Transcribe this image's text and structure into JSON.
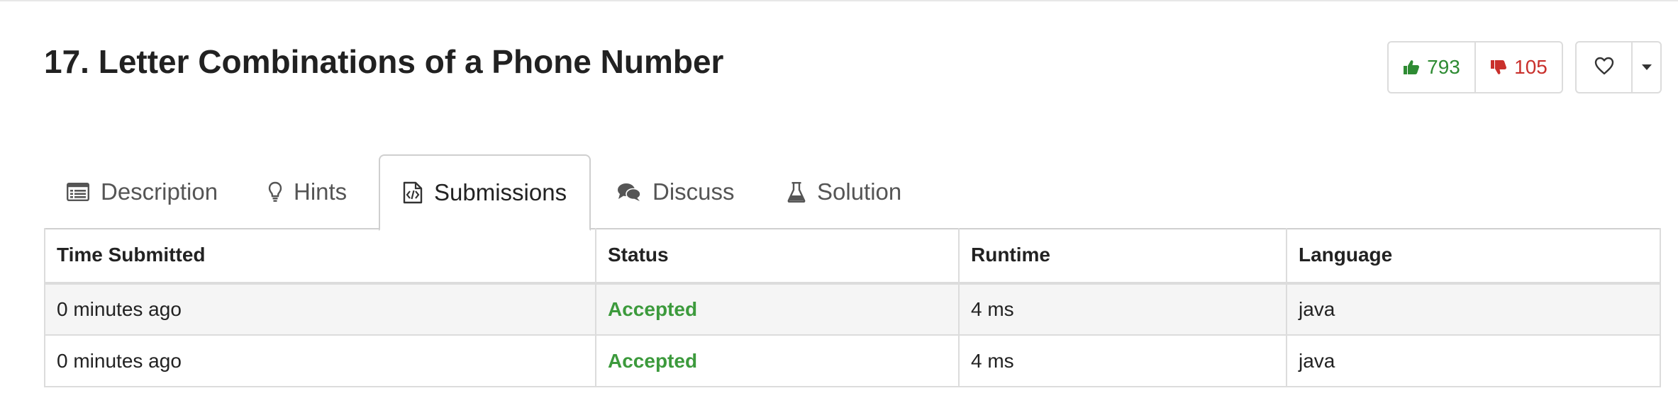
{
  "problem": {
    "title": "17. Letter Combinations of a Phone Number"
  },
  "votes": {
    "likes": "793",
    "dislikes": "105",
    "like_color": "#2e8b33",
    "dislike_color": "#c9302c"
  },
  "tabs": [
    {
      "label": "Description",
      "icon": "list-icon",
      "active": false
    },
    {
      "label": "Hints",
      "icon": "lightbulb-icon",
      "active": false
    },
    {
      "label": "Submissions",
      "icon": "code-file-icon",
      "active": true
    },
    {
      "label": "Discuss",
      "icon": "chat-bubbles-icon",
      "active": false
    },
    {
      "label": "Solution",
      "icon": "flask-icon",
      "active": false
    }
  ],
  "submissions": {
    "columns": [
      "Time Submitted",
      "Status",
      "Runtime",
      "Language"
    ],
    "rows": [
      {
        "time": "0 minutes ago",
        "status": "Accepted",
        "runtime": "4 ms",
        "language": "java"
      },
      {
        "time": "0 minutes ago",
        "status": "Accepted",
        "runtime": "4 ms",
        "language": "java"
      }
    ],
    "accepted_color": "#3c9a3c"
  }
}
